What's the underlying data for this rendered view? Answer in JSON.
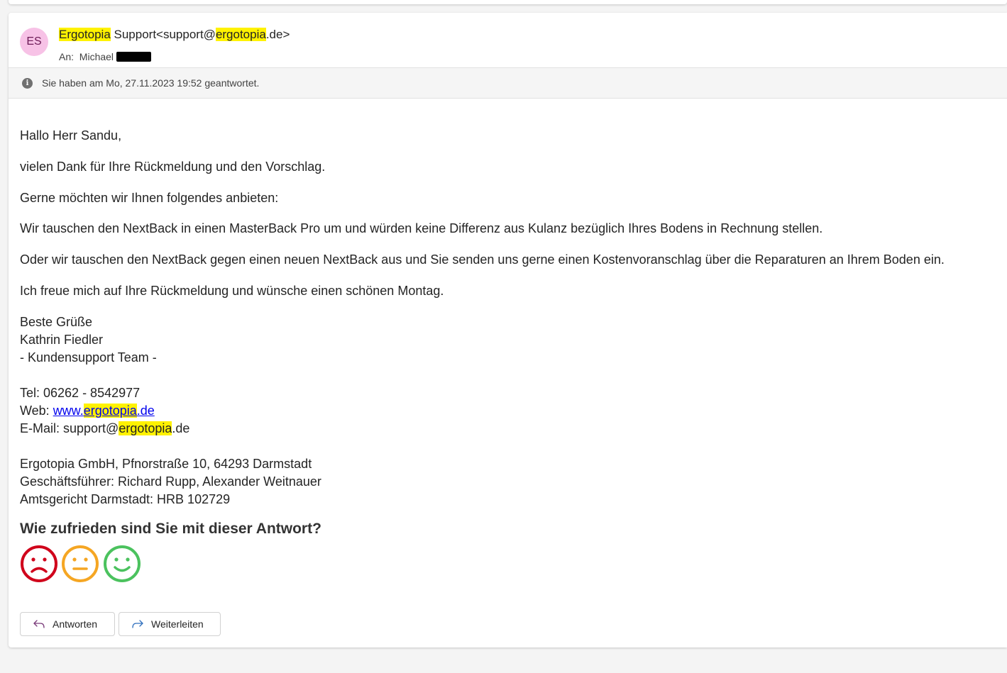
{
  "email": {
    "avatar_initials": "ES",
    "sender_name_highlight": "Ergotopia",
    "sender_name_rest": " Support<support@",
    "sender_domain_highlight": "ergotopia",
    "sender_domain_rest": ".de>",
    "to_label": "An:",
    "to_name": "Michael",
    "info_text": "Sie haben am Mo, 27.11.2023 19:52 geantwortet."
  },
  "body": {
    "greeting": "Hallo Herr Sandu,",
    "p1": "vielen Dank für Ihre Rückmeldung und den Vorschlag.",
    "p2": "Gerne möchten wir Ihnen folgendes anbieten:",
    "p3": "Wir tauschen den NextBack in einen MasterBack Pro um und würden keine Differenz aus Kulanz bezüglich Ihres Bodens in Rechnung stellen.",
    "p4": "Oder wir tauschen den NextBack gegen einen neuen NextBack aus und Sie senden uns gerne einen Kostenvoranschlag über die Reparaturen an Ihrem Boden ein.",
    "p5": "Ich freue mich auf Ihre Rückmeldung und wünsche einen schönen Montag.",
    "closing": "Beste Grüße",
    "signer": "Kathrin Fiedler",
    "team": "- Kundensupport Team -",
    "tel": "Tel: 06262 - 8542977",
    "web_label": "Web: ",
    "web_pre": "www.",
    "web_highlight": "ergotopia",
    "web_post": ".de",
    "mail_label": "E-Mail: support@",
    "mail_highlight": "ergotopia",
    "mail_post": ".de",
    "company": "Ergotopia GmbH, Pfnorstraße 10, 64293 Darmstadt",
    "ceo": "Geschäftsführer: Richard Rupp, Alexander Weitnauer",
    "court": "Amtsgericht Darmstadt: HRB 102729"
  },
  "survey": {
    "title": "Wie zufrieden sind Sie mit dieser Antwort?",
    "faces": [
      {
        "mood": "unhappy",
        "color": "#d0021b"
      },
      {
        "mood": "neutral",
        "color": "#f5a623"
      },
      {
        "mood": "happy",
        "color": "#4bc25e"
      }
    ]
  },
  "actions": {
    "reply_label": "Antworten",
    "forward_label": "Weiterleiten"
  }
}
